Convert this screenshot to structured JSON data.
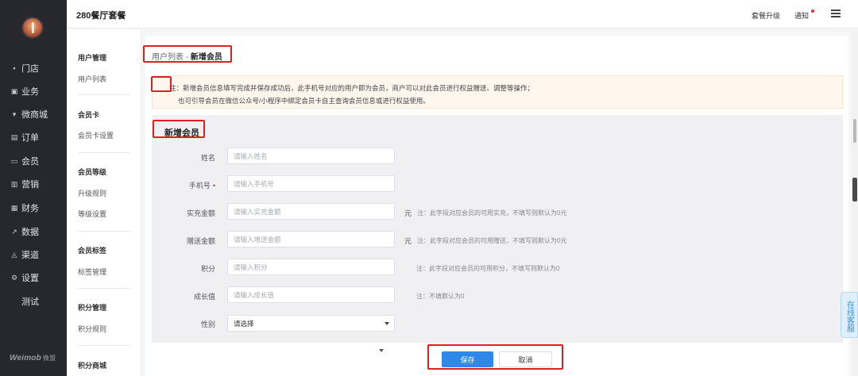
{
  "app": {
    "title": "280餐厅套餐"
  },
  "topbar": {
    "upgrade": "套餐升级",
    "notify": "通知"
  },
  "sidebar": {
    "items": [
      {
        "label": "门店",
        "icon": "store-icon",
        "glyph": "▪"
      },
      {
        "label": "业务",
        "icon": "briefcase-icon",
        "glyph": "▣"
      },
      {
        "label": "微商城",
        "icon": "shop-icon",
        "glyph": "▾"
      },
      {
        "label": "订单",
        "icon": "order-icon",
        "glyph": "▤"
      },
      {
        "label": "会员",
        "icon": "member-card-icon",
        "glyph": "▭"
      },
      {
        "label": "营销",
        "icon": "bar-chart-icon",
        "glyph": "▥"
      },
      {
        "label": "财务",
        "icon": "finance-icon",
        "glyph": "▦"
      },
      {
        "label": "数据",
        "icon": "line-chart-icon",
        "glyph": "↗"
      },
      {
        "label": "渠道",
        "icon": "channel-icon",
        "glyph": "◬"
      },
      {
        "label": "设置",
        "icon": "gear-icon",
        "glyph": "⚙"
      },
      {
        "label": "测试",
        "icon": "",
        "glyph": ""
      }
    ],
    "brand": "Weimob",
    "brand_cn": "微盟"
  },
  "subnav": {
    "groups": [
      {
        "title": "用户管理",
        "links": [
          "用户列表"
        ]
      },
      {
        "title": "会员卡",
        "links": [
          "会员卡设置"
        ]
      },
      {
        "title": "会员等级",
        "links": [
          "升级规则",
          "等级设置"
        ]
      },
      {
        "title": "会员标签",
        "links": [
          "标签管理"
        ]
      },
      {
        "title": "积分管理",
        "links": [
          "积分规则"
        ]
      },
      {
        "title": "积分商城",
        "links": []
      }
    ]
  },
  "breadcrumb": {
    "parent": "用户列表",
    "separator": " - ",
    "current": "新增会员"
  },
  "notice": {
    "line1": "注：新增会员信息填写完成并保存成功后，此手机号对应的用户即为会员，商户可以对此会员进行权益赠送、调整等操作；",
    "line2": "也可引导会员在微信公众号/小程序中绑定会员卡自主查询会员信息或进行权益使用。"
  },
  "form": {
    "title": "新增会员",
    "fields": {
      "name": {
        "label": "姓名",
        "placeholder": "请输入姓名"
      },
      "phone": {
        "label": "手机号",
        "placeholder": "请输入手机号",
        "required_mark": "•"
      },
      "recharge": {
        "label": "实充金额",
        "placeholder": "请输入实充金额",
        "unit": "元",
        "note": "注：此字段对应会员的可用实充，不填写则默认为0元"
      },
      "gift": {
        "label": "赠送金额",
        "placeholder": "请输入增送金额",
        "unit": "元",
        "note": "注：此字段对应会员的可用赠送，不填写则默认为0元"
      },
      "points": {
        "label": "积分",
        "placeholder": "请输入积分",
        "note": "注：此字段对应会员的可用积分，不填写则默认为0"
      },
      "growth": {
        "label": "成长值",
        "placeholder": "请输入成长值",
        "note": "注：不填默认为0"
      },
      "gender": {
        "label": "性别",
        "value": "请选择"
      }
    }
  },
  "actions": {
    "save": "保存",
    "cancel": "取消"
  },
  "support": {
    "label": "在线客服"
  },
  "colors": {
    "sidebar": "#27282d",
    "primary": "#2f87ea",
    "highlight": "#e02020",
    "notice_bg": "#fff7ee"
  }
}
